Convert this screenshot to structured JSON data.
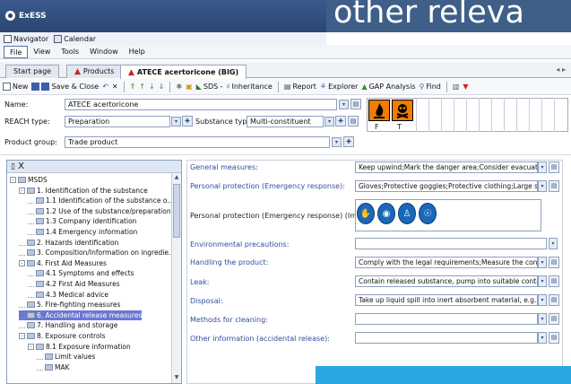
{
  "window": {
    "app_title": "ExESS",
    "overlay_title": "other releva"
  },
  "navrow": {
    "navigator": "Navigator",
    "calendar": "Calendar"
  },
  "menu": [
    "File",
    "View",
    "Tools",
    "Window",
    "Help"
  ],
  "tabs": [
    {
      "label": "Start page"
    },
    {
      "label": "Products"
    },
    {
      "label": "ATECE acertoricone (BIG)"
    }
  ],
  "toolbar": {
    "new": "New",
    "save_close": "Save & Close",
    "sds": "SDS -",
    "inheritance": "Inheritance",
    "report": "Report",
    "explorer": "Explorer",
    "gap": "GAP Analysis",
    "find": "Find"
  },
  "form": {
    "name_label": "Name:",
    "name_value": "ATECE acertoricone",
    "reach_label": "REACH type:",
    "reach_value": "Preparation",
    "subst_label": "Substance type:",
    "subst_value": "Multi-constituent",
    "group_label": "Product group:",
    "group_value": "Trade product",
    "hazard_codes": [
      "F",
      "T"
    ]
  },
  "tree": {
    "header": "X",
    "items": [
      {
        "label": "MSDS",
        "indent": 0,
        "box": "-"
      },
      {
        "label": "1. Identification of the substance",
        "indent": 1,
        "box": "-"
      },
      {
        "label": "1.1 Identification of the substance o...",
        "indent": 2,
        "box": ""
      },
      {
        "label": "1.2 Use of the substance/preparation",
        "indent": 2,
        "box": ""
      },
      {
        "label": "1.3 Company identification",
        "indent": 2,
        "box": ""
      },
      {
        "label": "1.4 Emergency information",
        "indent": 2,
        "box": ""
      },
      {
        "label": "2. Hazards identification",
        "indent": 1,
        "box": ""
      },
      {
        "label": "3. Composition/Information on ingredie...",
        "indent": 1,
        "box": ""
      },
      {
        "label": "4. First Aid Measures",
        "indent": 1,
        "box": "-"
      },
      {
        "label": "4.1 Symptoms and effects",
        "indent": 2,
        "box": ""
      },
      {
        "label": "4.2 First Aid Measures",
        "indent": 2,
        "box": ""
      },
      {
        "label": "4.3 Medical advice",
        "indent": 2,
        "box": ""
      },
      {
        "label": "5. Fire-fighting measures",
        "indent": 1,
        "box": ""
      },
      {
        "label": "6. Accidental release measures",
        "indent": 1,
        "box": "",
        "selected": true
      },
      {
        "label": "7. Handling and storage",
        "indent": 1,
        "box": ""
      },
      {
        "label": "8. Exposure controls",
        "indent": 1,
        "box": "-"
      },
      {
        "label": "8.1 Exposure information",
        "indent": 2,
        "box": "-"
      },
      {
        "label": "Limit values",
        "indent": 3,
        "box": ""
      },
      {
        "label": "MAK",
        "indent": 3,
        "box": ""
      }
    ]
  },
  "details": {
    "general_label": "General measures:",
    "general_value": "Keep upwind;Mark the danger area;Consider evacuation;...",
    "pp_label": "Personal protection (Emergency response):",
    "pp_value": "Gloves;Protective goggles;Protective clothing;Large spills/i...",
    "ppimg_label": "Personal protection (Emergency response) (Images):",
    "env_label": "Environmental precautions:",
    "env_value": "",
    "handling_label": "Handling the product:",
    "handling_value": "Comply with the legal requirements;Measure the concentr...",
    "leak_label": "Leak:",
    "leak_value": "Contain released substance, pump into suitable containers...",
    "disposal_label": "Disposal:",
    "disposal_value": "Take up liquid spill into inert absorbent material, e.g.: san...",
    "cleaning_label": "Methods for cleaning:",
    "cleaning_value": "",
    "other_label": "Other information (accidental release):",
    "other_value": ""
  },
  "colors": {
    "accent": "#2b4570",
    "selection": "#6a78d1",
    "hazard_orange": "#f07c00",
    "link_blue": "#2f4f9f"
  },
  "icons": [
    "navigator-icon",
    "calendar-icon",
    "product-icon",
    "new-icon",
    "save-icon",
    "undo-icon",
    "delete-icon",
    "hazard-flame-icon",
    "hazard-skull-icon",
    "gloves-icon",
    "goggles-icon",
    "clothing-icon",
    "respirator-icon"
  ]
}
